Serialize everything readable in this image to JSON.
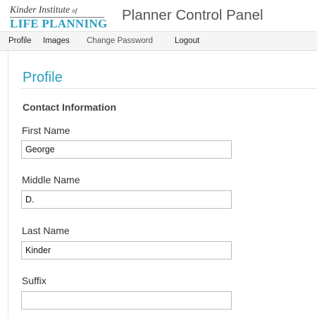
{
  "logo": {
    "line1": "Kinder Institute",
    "line1_suffix": "of",
    "line2": "LIFE PLANNING"
  },
  "header": {
    "title": "Planner Control Panel"
  },
  "nav": {
    "items": [
      {
        "label": "Profile"
      },
      {
        "label": "Images"
      },
      {
        "label": "Change Password"
      },
      {
        "label": "Logout"
      }
    ]
  },
  "page": {
    "title": "Profile",
    "section": "Contact Information"
  },
  "form": {
    "first_name": {
      "label": "First Name",
      "value": "George"
    },
    "middle_name": {
      "label": "Middle Name",
      "value": "D."
    },
    "last_name": {
      "label": "Last Name",
      "value": "Kinder"
    },
    "suffix": {
      "label": "Suffix",
      "value": ""
    }
  },
  "colors": {
    "accent": "#2a9ec0",
    "nav_background": "#f5f5f5"
  }
}
